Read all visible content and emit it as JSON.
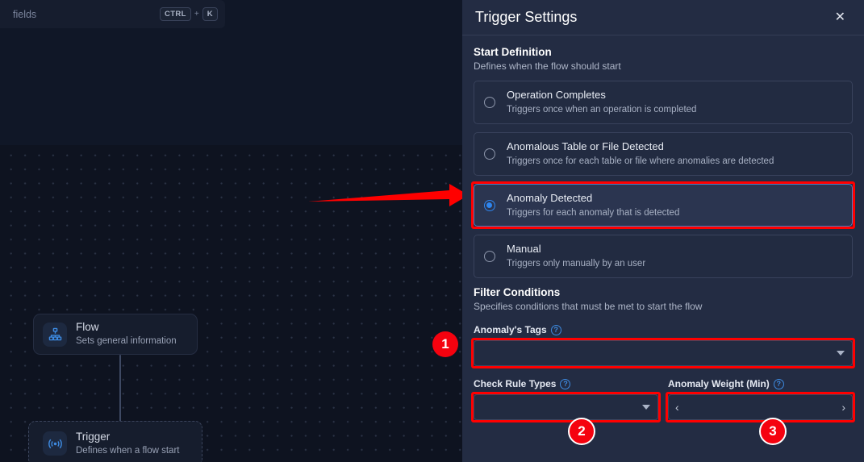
{
  "canvas": {
    "search": {
      "placeholder": "fields",
      "shortcut_key1": "CTRL",
      "shortcut_plus": "+",
      "shortcut_key2": "K"
    },
    "nodes": [
      {
        "title": "Flow",
        "subtitle": "Sets general information",
        "icon": "sitemap-icon"
      },
      {
        "title": "Trigger",
        "subtitle": "Defines when a flow start",
        "icon": "broadcast-icon"
      }
    ]
  },
  "panel": {
    "title": "Trigger Settings",
    "close_icon": "✕",
    "start_definition": {
      "title": "Start Definition",
      "subtitle": "Defines when the flow should start",
      "options": [
        {
          "title": "Operation Completes",
          "desc": "Triggers once when an operation is completed",
          "selected": false
        },
        {
          "title": "Anomalous Table or File Detected",
          "desc": "Triggers once for each table or file where anomalies are detected",
          "selected": false
        },
        {
          "title": "Anomaly Detected",
          "desc": "Triggers for each anomaly that is detected",
          "selected": true
        },
        {
          "title": "Manual",
          "desc": "Triggers only manually by an user",
          "selected": false
        }
      ]
    },
    "filter_conditions": {
      "title": "Filter Conditions",
      "subtitle": "Specifies conditions that must be met to start the flow",
      "fields": [
        {
          "label": "Anomaly's Tags",
          "help": "?",
          "value": "",
          "control": "dropdown"
        },
        {
          "label": "Check Rule Types",
          "help": "?",
          "value": "",
          "control": "dropdown"
        },
        {
          "label": "Anomaly Weight (Min)",
          "help": "?",
          "value": "",
          "control": "stepper",
          "prev_icon": "‹",
          "next_icon": "›"
        }
      ]
    }
  },
  "annotations": {
    "badges": [
      {
        "number": "1"
      },
      {
        "number": "2"
      },
      {
        "number": "3"
      }
    ],
    "arrow_color": "#ff0000",
    "highlight_color": "#ff0000"
  }
}
